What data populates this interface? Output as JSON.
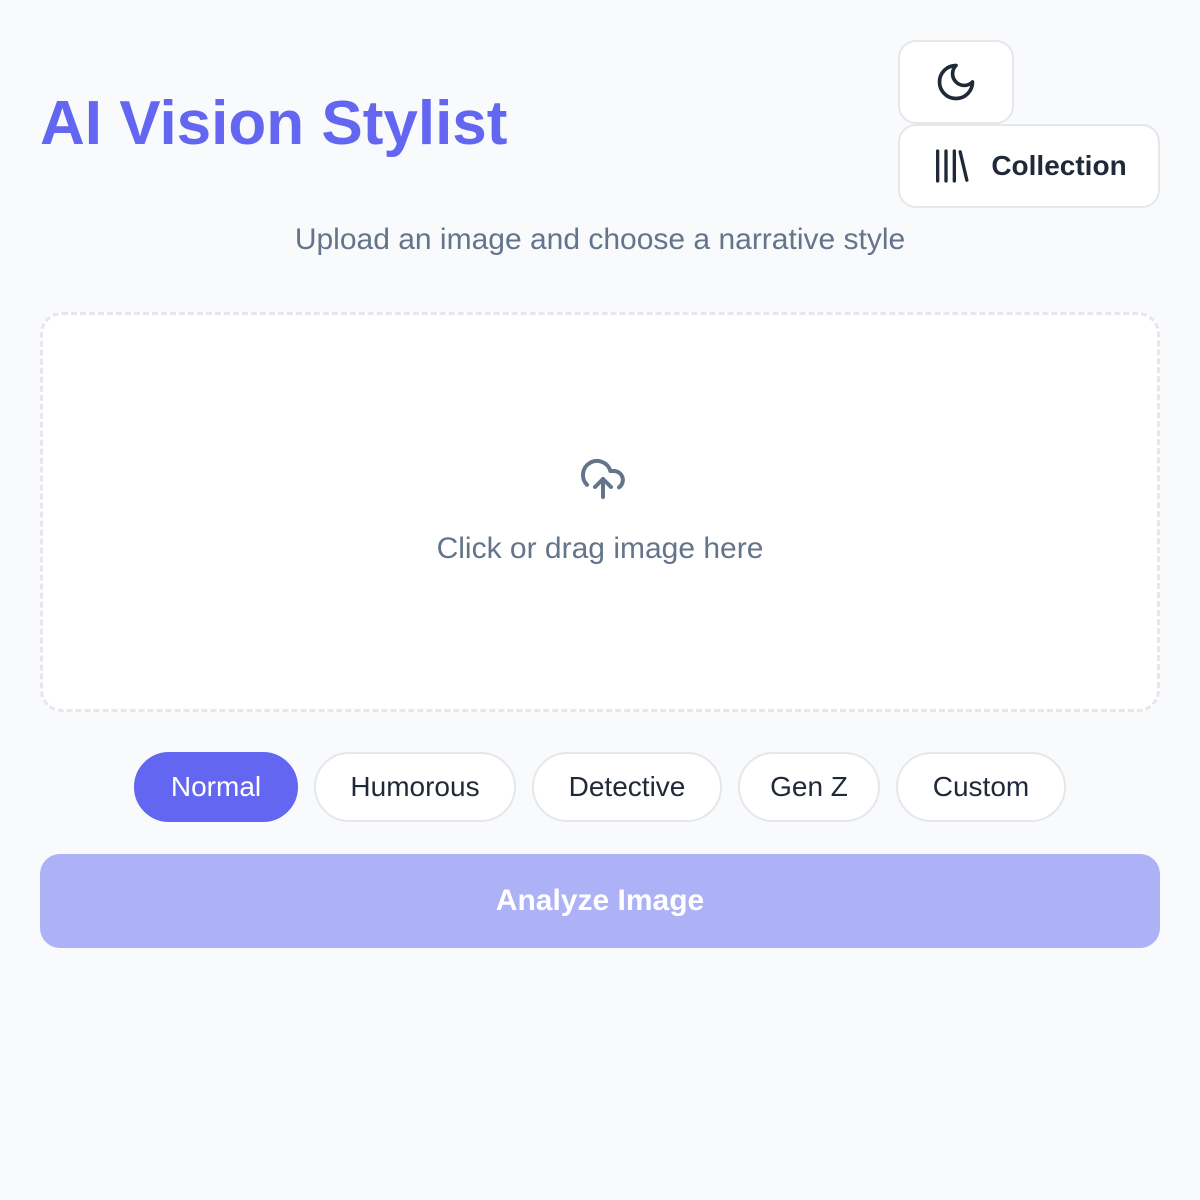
{
  "header": {
    "title": "AI Vision Stylist",
    "theme_toggle_icon": "moon-icon",
    "collection_icon": "library-icon",
    "collection_label": "Collection"
  },
  "subtitle": "Upload an image and choose a narrative style",
  "dropzone": {
    "icon": "cloud-upload-icon",
    "text": "Click or drag image here"
  },
  "styles": {
    "selected": "Normal",
    "options": [
      {
        "label": "Normal",
        "active": true
      },
      {
        "label": "Humorous",
        "active": false
      },
      {
        "label": "Detective",
        "active": false
      },
      {
        "label": "Gen Z",
        "active": false
      },
      {
        "label": "Custom",
        "active": false
      }
    ]
  },
  "analyze_button": {
    "label": "Analyze Image",
    "disabled": true
  },
  "colors": {
    "accent": "#6366f1",
    "accent_disabled": "#adb1f6",
    "background": "#f8fafc",
    "muted_text": "#64748b",
    "dark_text": "#1f2937",
    "border": "#e5e7eb"
  }
}
